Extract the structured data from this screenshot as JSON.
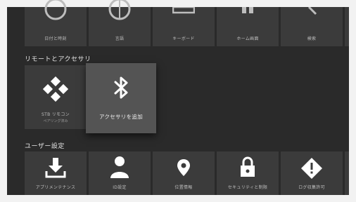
{
  "top_row": [
    {
      "label": "日付と時刻",
      "icon": "clock-icon"
    },
    {
      "label": "言語",
      "icon": "globe-icon"
    },
    {
      "label": "キーボード",
      "icon": "keyboard-icon"
    },
    {
      "label": "ホーム画面",
      "icon": "home-screen-icon"
    },
    {
      "label": "検索",
      "icon": "search-icon"
    }
  ],
  "remote_section": {
    "title": "リモートとアクセサリ",
    "items": [
      {
        "label": "STB リモコン",
        "sub": "ペアリング済み",
        "icon": "gamepad-icon"
      },
      {
        "label": "アクセサリを追加",
        "icon": "bluetooth-icon"
      }
    ]
  },
  "user_section": {
    "title": "ユーザー設定",
    "items": [
      {
        "label": "アプリメンテナンス",
        "icon": "download-icon"
      },
      {
        "label": "ID設定",
        "icon": "person-icon"
      },
      {
        "label": "位置情報",
        "icon": "location-pin-icon"
      },
      {
        "label": "セキュリティと制限",
        "icon": "lock-icon"
      },
      {
        "label": "ログ収集許可",
        "icon": "alert-icon"
      }
    ]
  },
  "colors": {
    "background": "#2a2a2a",
    "tile": "#3b3b3b",
    "focused_tile": "#545454"
  }
}
